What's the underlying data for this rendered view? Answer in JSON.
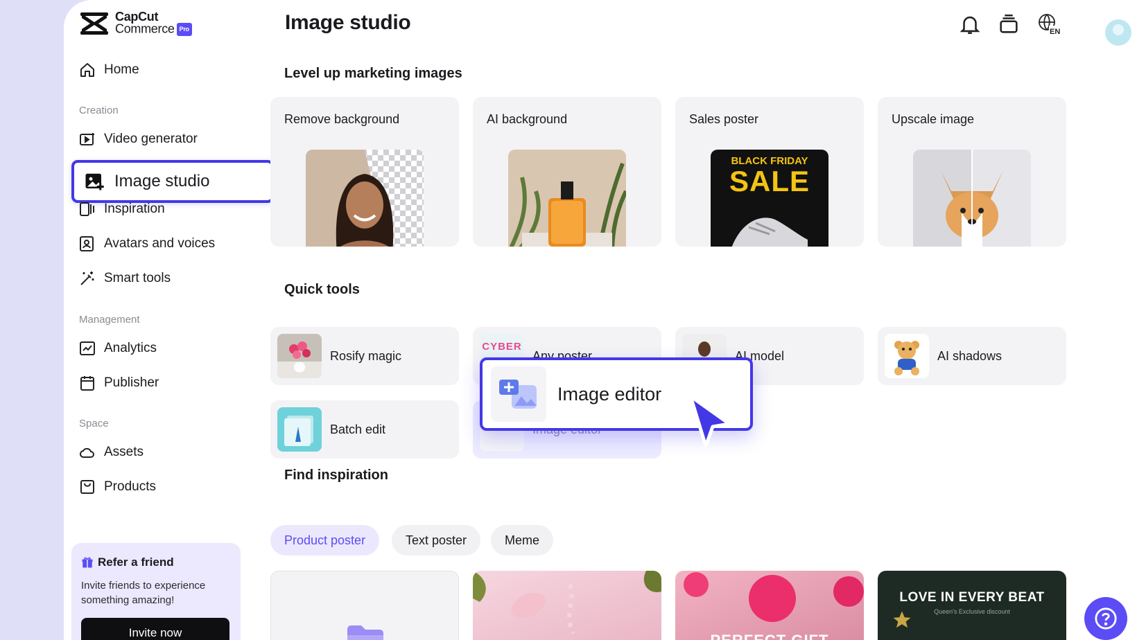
{
  "brand": {
    "name_line1": "CapCut",
    "name_line2": "Commerce",
    "badge": "Pro"
  },
  "header": {
    "title": "Image studio",
    "language": "EN"
  },
  "sidebar": {
    "home": "Home",
    "sections": {
      "creation": "Creation",
      "management": "Management",
      "space": "Space"
    },
    "items": {
      "video_generator": "Video generator",
      "image_studio": "Image studio",
      "inspiration": "Inspiration",
      "avatars": "Avatars and voices",
      "smart_tools": "Smart tools",
      "analytics": "Analytics",
      "publisher": "Publisher",
      "assets": "Assets",
      "products": "Products"
    },
    "refer": {
      "title": "Refer a friend",
      "description": "Invite friends to experience something amazing!",
      "button": "Invite now"
    }
  },
  "marketing": {
    "heading": "Level up marketing images",
    "cards": [
      {
        "label": "Remove background"
      },
      {
        "label": "AI background"
      },
      {
        "label": "Sales poster",
        "poster_top": "BLACK FRIDAY",
        "poster_main": "SALE"
      },
      {
        "label": "Upscale image"
      }
    ]
  },
  "quick_tools": {
    "heading": "Quick tools",
    "items": [
      {
        "label": "Rosify magic"
      },
      {
        "label": "Any poster",
        "thumb_text": "CYBER"
      },
      {
        "label": "AI model"
      },
      {
        "label": "AI shadows"
      },
      {
        "label": "Batch edit"
      },
      {
        "label": "Image editor"
      }
    ],
    "popup_label": "Image editor"
  },
  "inspiration": {
    "heading": "Find inspiration",
    "chips": [
      "Product poster",
      "Text poster",
      "Meme"
    ],
    "active_chip": "Product poster",
    "cards": [
      {
        "text": ""
      },
      {
        "text": ""
      },
      {
        "text": "PERFECT GIFT"
      },
      {
        "text": "LOVE IN EVERY BEAT",
        "subtext": "Queen's Exclusive discount"
      }
    ]
  },
  "colors": {
    "accent": "#5b4cf5",
    "highlight": "#4338e6"
  }
}
